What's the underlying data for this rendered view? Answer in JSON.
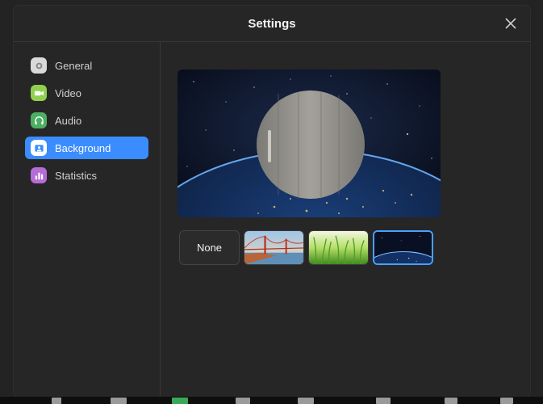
{
  "dialog": {
    "title": "Settings"
  },
  "sidebar": {
    "items": [
      {
        "label": "General",
        "icon": "gear-icon",
        "active": false
      },
      {
        "label": "Video",
        "icon": "video-camera-icon",
        "active": false
      },
      {
        "label": "Audio",
        "icon": "headphones-icon",
        "active": false
      },
      {
        "label": "Background",
        "icon": "background-icon",
        "active": true
      },
      {
        "label": "Statistics",
        "icon": "bar-chart-icon",
        "active": false
      }
    ]
  },
  "background": {
    "preview_name": "Earth at night",
    "options": [
      {
        "label": "None",
        "kind": "none",
        "selected": false
      },
      {
        "label": "",
        "kind": "golden-gate-bridge",
        "selected": false
      },
      {
        "label": "",
        "kind": "grass",
        "selected": false
      },
      {
        "label": "",
        "kind": "earth-from-space",
        "selected": true
      }
    ]
  },
  "colors": {
    "accent": "#3b8cff",
    "dialog_bg": "#262626",
    "selected_border": "#4aa0ff"
  }
}
